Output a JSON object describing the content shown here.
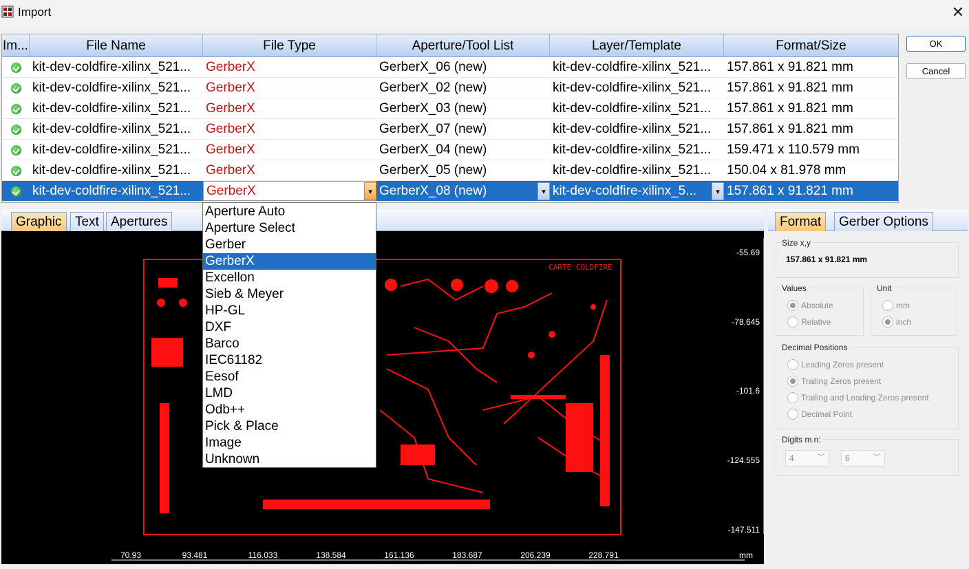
{
  "window": {
    "title": "Import",
    "close": "✕"
  },
  "grid": {
    "headers": [
      "Im...",
      "File Name",
      "File Type",
      "Aperture/Tool List",
      "Layer/Template",
      "Format/Size"
    ],
    "rows": [
      {
        "file": "kit-dev-coldfire-xilinx_521...",
        "type": "GerberX",
        "ap": "GerberX_06 (new)",
        "layer": "kit-dev-coldfire-xilinx_521...",
        "size": "157.861 x 91.821 mm"
      },
      {
        "file": "kit-dev-coldfire-xilinx_521...",
        "type": "GerberX",
        "ap": "GerberX_02 (new)",
        "layer": "kit-dev-coldfire-xilinx_521...",
        "size": "157.861 x 91.821 mm"
      },
      {
        "file": "kit-dev-coldfire-xilinx_521...",
        "type": "GerberX",
        "ap": "GerberX_03 (new)",
        "layer": "kit-dev-coldfire-xilinx_521...",
        "size": "157.861 x 91.821 mm"
      },
      {
        "file": "kit-dev-coldfire-xilinx_521...",
        "type": "GerberX",
        "ap": "GerberX_07 (new)",
        "layer": "kit-dev-coldfire-xilinx_521...",
        "size": "157.861 x 91.821 mm"
      },
      {
        "file": "kit-dev-coldfire-xilinx_521...",
        "type": "GerberX",
        "ap": "GerberX_04 (new)",
        "layer": "kit-dev-coldfire-xilinx_521...",
        "size": "159.471 x 110.579 mm"
      },
      {
        "file": "kit-dev-coldfire-xilinx_521...",
        "type": "GerberX",
        "ap": "GerberX_05 (new)",
        "layer": "kit-dev-coldfire-xilinx_521...",
        "size": "150.04 x 81.978 mm"
      },
      {
        "file": "kit-dev-coldfire-xilinx_521...",
        "type": "GerberX",
        "ap": "GerberX_08 (new)",
        "layer": "kit-dev-coldfire-xilinx_5...",
        "size": "157.861 x 91.821 mm"
      }
    ]
  },
  "buttons": {
    "ok": "OK",
    "cancel": "Cancel"
  },
  "left_tabs": [
    "Graphic",
    "Text",
    "Apertures"
  ],
  "right_tabs": [
    "Format",
    "Gerber Options"
  ],
  "file_type_options": [
    "Aperture Auto",
    "Aperture Select",
    "Gerber",
    "GerberX",
    "Excellon",
    "Sieb & Meyer",
    "HP-GL",
    "DXF",
    "Barco",
    "IEC61182",
    "Eesof",
    "LMD",
    "Odb++",
    "Pick & Place",
    "Image",
    "Unknown"
  ],
  "file_type_selected": "GerberX",
  "canvas": {
    "y_labels": [
      "-55.69",
      "-78.645",
      "-101.6",
      "-124.555",
      "-147.511"
    ],
    "x_labels": [
      "70.93",
      "93.481",
      "116.033",
      "138.584",
      "161.136",
      "183.687",
      "206.239",
      "228.791"
    ],
    "unit": "mm",
    "board_text": "CARTE COLDFIRE",
    "trace_color": "#ff1010"
  },
  "format": {
    "size_label": "Size x,y",
    "size_value": "157.861 x 91.821 mm",
    "values_label": "Values",
    "values_options": [
      "Absolute",
      "Relative"
    ],
    "values_selected": "Absolute",
    "unit_label": "Unit",
    "unit_options": [
      "mm",
      "inch"
    ],
    "unit_selected": "inch",
    "decimal_label": "Decimal Positions",
    "decimal_options": [
      "Leading Zeros present",
      "Trailing Zeros present",
      "Trailing and Leading Zeros present",
      "Decimal Point"
    ],
    "decimal_selected": "Trailing Zeros present",
    "digits_label": "Digits m.n:",
    "digits_m": "4",
    "digits_n": "6"
  }
}
